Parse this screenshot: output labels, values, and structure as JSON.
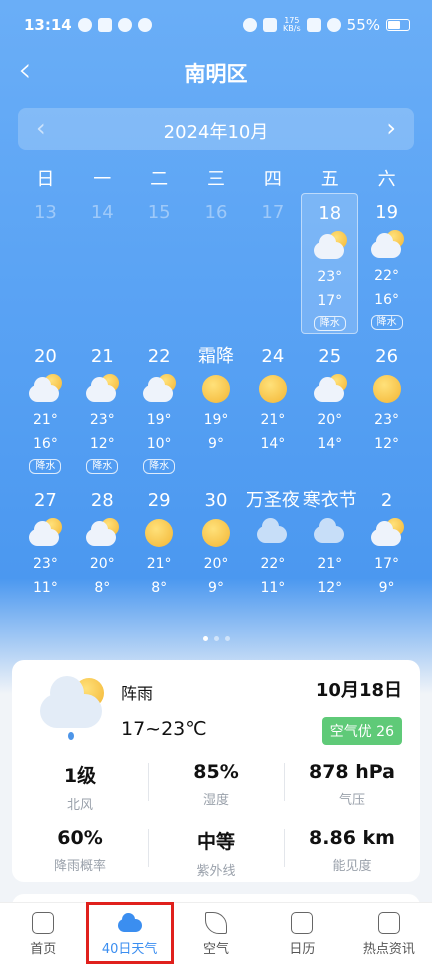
{
  "status_bar": {
    "time": "13:14",
    "speed_top": "175",
    "speed_bottom": "KB/s",
    "battery": "55%"
  },
  "header": {
    "title": "南明区"
  },
  "month": {
    "label": "2024年10月"
  },
  "weekdays": [
    "日",
    "一",
    "二",
    "三",
    "四",
    "五",
    "六"
  ],
  "weeks": [
    [
      {
        "num": "13",
        "past": true
      },
      {
        "num": "14",
        "past": true
      },
      {
        "num": "15",
        "past": true
      },
      {
        "num": "16",
        "past": true
      },
      {
        "num": "17",
        "past": true
      },
      {
        "num": "18",
        "icon": "cloud-sun",
        "hi": "23°",
        "lo": "17°",
        "badge": "降水",
        "selected": true
      },
      {
        "num": "19",
        "icon": "cloud-sun",
        "hi": "22°",
        "lo": "16°",
        "badge": "降水"
      }
    ],
    [
      {
        "num": "20",
        "icon": "cloud-sun",
        "hi": "21°",
        "lo": "16°",
        "badge": "降水"
      },
      {
        "num": "21",
        "icon": "cloud-sun",
        "hi": "23°",
        "lo": "12°",
        "badge": "降水"
      },
      {
        "num": "22",
        "icon": "cloud-sun",
        "hi": "19°",
        "lo": "10°",
        "badge": "降水"
      },
      {
        "num": "霜降",
        "icon": "sun",
        "hi": "19°",
        "lo": "9°"
      },
      {
        "num": "24",
        "icon": "sun",
        "hi": "21°",
        "lo": "14°"
      },
      {
        "num": "25",
        "icon": "cloud-sun",
        "hi": "20°",
        "lo": "14°"
      },
      {
        "num": "26",
        "icon": "sun",
        "hi": "23°",
        "lo": "12°"
      }
    ],
    [
      {
        "num": "27",
        "icon": "cloud-sun",
        "hi": "23°",
        "lo": "11°"
      },
      {
        "num": "28",
        "icon": "cloud-sun",
        "hi": "20°",
        "lo": "8°"
      },
      {
        "num": "29",
        "icon": "sun",
        "hi": "21°",
        "lo": "8°"
      },
      {
        "num": "30",
        "icon": "sun",
        "hi": "20°",
        "lo": "9°"
      },
      {
        "num": "万圣夜",
        "icon": "cloud-blue",
        "hi": "22°",
        "lo": "11°"
      },
      {
        "num": "寒衣节",
        "icon": "cloud-blue",
        "hi": "21°",
        "lo": "12°"
      },
      {
        "num": "2",
        "icon": "cloud-sun",
        "hi": "17°",
        "lo": "9°"
      }
    ]
  ],
  "detail": {
    "weather_name": "阵雨",
    "temp_range": "17~23℃",
    "date": "10月18日",
    "aqi": "空气优 26",
    "aqi_color": "#5fca78",
    "stats": [
      {
        "value": "1级",
        "label": "北风"
      },
      {
        "value": "85%",
        "label": "湿度"
      },
      {
        "value": "878 hPa",
        "label": "气压"
      },
      {
        "value": "60%",
        "label": "降雨概率"
      },
      {
        "value": "中等",
        "label": "紫外线"
      },
      {
        "value": "8.86 km",
        "label": "能见度"
      }
    ]
  },
  "nav": [
    {
      "label": "首页",
      "icon": "home-icon"
    },
    {
      "label": "40日天气",
      "icon": "cloud-icon",
      "active": true
    },
    {
      "label": "空气",
      "icon": "leaf-icon"
    },
    {
      "label": "日历",
      "icon": "calendar-icon"
    },
    {
      "label": "热点资讯",
      "icon": "news-icon"
    }
  ],
  "accent_color": "#3b8ef0",
  "highlight_color": "#e0201c"
}
